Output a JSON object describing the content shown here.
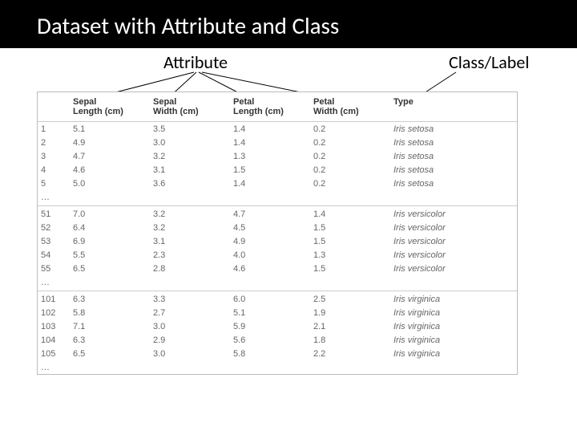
{
  "title": "Dataset with Attribute and Class",
  "labels": {
    "attribute": "Attribute",
    "class": "Class/Label"
  },
  "headers": {
    "idx": "",
    "sepal_length": "Sepal\nLength (cm)",
    "sepal_width": "Sepal\nWidth (cm)",
    "petal_length": "Petal\nLength (cm)",
    "petal_width": "Petal\nWidth (cm)",
    "type": "Type"
  },
  "rows": [
    {
      "idx": "1",
      "sl": "5.1",
      "sw": "3.5",
      "pl": "1.4",
      "pw": "0.2",
      "type": "Iris setosa"
    },
    {
      "idx": "2",
      "sl": "4.9",
      "sw": "3.0",
      "pl": "1.4",
      "pw": "0.2",
      "type": "Iris setosa"
    },
    {
      "idx": "3",
      "sl": "4.7",
      "sw": "3.2",
      "pl": "1.3",
      "pw": "0.2",
      "type": "Iris setosa"
    },
    {
      "idx": "4",
      "sl": "4.6",
      "sw": "3.1",
      "pl": "1.5",
      "pw": "0.2",
      "type": "Iris setosa"
    },
    {
      "idx": "5",
      "sl": "5.0",
      "sw": "3.6",
      "pl": "1.4",
      "pw": "0.2",
      "type": "Iris setosa"
    },
    {
      "idx": "…",
      "sl": "",
      "sw": "",
      "pl": "",
      "pw": "",
      "type": "",
      "gap": true
    },
    {
      "idx": "51",
      "sl": "7.0",
      "sw": "3.2",
      "pl": "4.7",
      "pw": "1.4",
      "type": "Iris versicolor",
      "postgap": true
    },
    {
      "idx": "52",
      "sl": "6.4",
      "sw": "3.2",
      "pl": "4.5",
      "pw": "1.5",
      "type": "Iris versicolor"
    },
    {
      "idx": "53",
      "sl": "6.9",
      "sw": "3.1",
      "pl": "4.9",
      "pw": "1.5",
      "type": "Iris versicolor"
    },
    {
      "idx": "54",
      "sl": "5.5",
      "sw": "2.3",
      "pl": "4.0",
      "pw": "1.3",
      "type": "Iris versicolor"
    },
    {
      "idx": "55",
      "sl": "6.5",
      "sw": "2.8",
      "pl": "4.6",
      "pw": "1.5",
      "type": "Iris versicolor"
    },
    {
      "idx": "…",
      "sl": "",
      "sw": "",
      "pl": "",
      "pw": "",
      "type": "",
      "gap": true
    },
    {
      "idx": "101",
      "sl": "6.3",
      "sw": "3.3",
      "pl": "6.0",
      "pw": "2.5",
      "type": "Iris virginica",
      "postgap": true
    },
    {
      "idx": "102",
      "sl": "5.8",
      "sw": "2.7",
      "pl": "5.1",
      "pw": "1.9",
      "type": "Iris virginica"
    },
    {
      "idx": "103",
      "sl": "7.1",
      "sw": "3.0",
      "pl": "5.9",
      "pw": "2.1",
      "type": "Iris virginica"
    },
    {
      "idx": "104",
      "sl": "6.3",
      "sw": "2.9",
      "pl": "5.6",
      "pw": "1.8",
      "type": "Iris virginica"
    },
    {
      "idx": "105",
      "sl": "6.5",
      "sw": "3.0",
      "pl": "5.8",
      "pw": "2.2",
      "type": "Iris virginica"
    },
    {
      "idx": "…",
      "sl": "",
      "sw": "",
      "pl": "",
      "pw": "",
      "type": ""
    }
  ]
}
